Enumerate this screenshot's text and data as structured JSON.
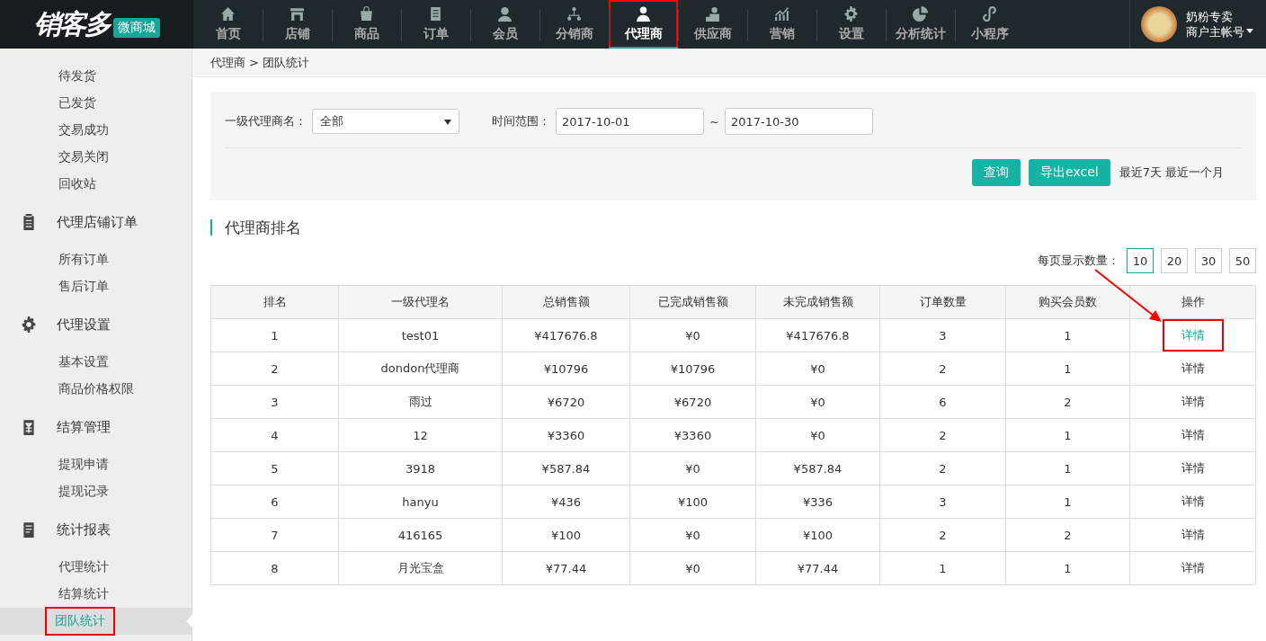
{
  "header": {
    "logo": "销客多",
    "logo_badge": "微商城",
    "nav": [
      {
        "label": "首页",
        "selected": false,
        "annotated": false
      },
      {
        "label": "店铺",
        "selected": false,
        "annotated": false
      },
      {
        "label": "商品",
        "selected": false,
        "annotated": false
      },
      {
        "label": "订单",
        "selected": false,
        "annotated": false
      },
      {
        "label": "会员",
        "selected": false,
        "annotated": false
      },
      {
        "label": "分销商",
        "selected": false,
        "annotated": false
      },
      {
        "label": "代理商",
        "selected": true,
        "annotated": true
      },
      {
        "label": "供应商",
        "selected": false,
        "annotated": false
      },
      {
        "label": "营销",
        "selected": false,
        "annotated": false
      },
      {
        "label": "设置",
        "selected": false,
        "annotated": false
      },
      {
        "label": "分析统计",
        "selected": false,
        "annotated": false
      },
      {
        "label": "小程序",
        "selected": false,
        "annotated": false
      }
    ],
    "account": {
      "name": "奶粉专卖",
      "role": "商户主帐号"
    }
  },
  "sidebar": [
    {
      "kind": "item",
      "label": "待发货",
      "selected": false,
      "annotated": false
    },
    {
      "kind": "item",
      "label": "已发货",
      "selected": false,
      "annotated": false
    },
    {
      "kind": "item",
      "label": "交易成功",
      "selected": false,
      "annotated": false
    },
    {
      "kind": "item",
      "label": "交易关闭",
      "selected": false,
      "annotated": false
    },
    {
      "kind": "item",
      "label": "回收站",
      "selected": false,
      "annotated": false
    },
    {
      "kind": "section",
      "label": "代理店铺订单"
    },
    {
      "kind": "item",
      "label": "所有订单",
      "selected": false,
      "annotated": false
    },
    {
      "kind": "item",
      "label": "售后订单",
      "selected": false,
      "annotated": false
    },
    {
      "kind": "section",
      "label": "代理设置"
    },
    {
      "kind": "item",
      "label": "基本设置",
      "selected": false,
      "annotated": false
    },
    {
      "kind": "item",
      "label": "商品价格权限",
      "selected": false,
      "annotated": false
    },
    {
      "kind": "section",
      "label": "结算管理"
    },
    {
      "kind": "item",
      "label": "提现申请",
      "selected": false,
      "annotated": false
    },
    {
      "kind": "item",
      "label": "提现记录",
      "selected": false,
      "annotated": false
    },
    {
      "kind": "section",
      "label": "统计报表"
    },
    {
      "kind": "item",
      "label": "代理统计",
      "selected": false,
      "annotated": false
    },
    {
      "kind": "item",
      "label": "结算统计",
      "selected": false,
      "annotated": false
    },
    {
      "kind": "item",
      "label": "团队统计",
      "selected": true,
      "annotated": true
    }
  ],
  "breadcrumb": [
    "代理商",
    "团队统计"
  ],
  "breadcrumb_separator": ">",
  "filters": {
    "agent_label": "一级代理商名：",
    "agent_value": "全部",
    "date_label": "时间范围：",
    "date_from": "2017-10-01",
    "date_separator": "~",
    "date_to": "2017-10-30",
    "buttons": [
      "查询",
      "导出excel"
    ],
    "quick_ranges": [
      "最近7天",
      "最近一个月"
    ]
  },
  "section_title": "代理商排名",
  "page_size": {
    "label": "每页显示数量：",
    "options": [
      {
        "label": "10",
        "selected": true
      },
      {
        "label": "20",
        "selected": false
      },
      {
        "label": "30",
        "selected": false
      },
      {
        "label": "50",
        "selected": false
      }
    ]
  },
  "table": {
    "columns": [
      "排名",
      "一级代理名",
      "总销售额",
      "已完成销售额",
      "未完成销售额",
      "订单数量",
      "购买会员数",
      "操作"
    ],
    "rows": [
      {
        "cells": [
          "1",
          "test01",
          "¥417676.8",
          "¥0",
          "¥417676.8",
          "3",
          "1"
        ],
        "action": "详情",
        "highlighted": true,
        "annotated": true
      },
      {
        "cells": [
          "2",
          "dondon代理商",
          "¥10796",
          "¥10796",
          "¥0",
          "2",
          "1"
        ],
        "action": "详情",
        "highlighted": false,
        "annotated": false
      },
      {
        "cells": [
          "3",
          "雨过",
          "¥6720",
          "¥6720",
          "¥0",
          "6",
          "2"
        ],
        "action": "详情",
        "highlighted": false,
        "annotated": false
      },
      {
        "cells": [
          "4",
          "12",
          "¥3360",
          "¥3360",
          "¥0",
          "2",
          "1"
        ],
        "action": "详情",
        "highlighted": false,
        "annotated": false
      },
      {
        "cells": [
          "5",
          "3918",
          "¥587.84",
          "¥0",
          "¥587.84",
          "2",
          "1"
        ],
        "action": "详情",
        "highlighted": false,
        "annotated": false
      },
      {
        "cells": [
          "6",
          "hanyu",
          "¥436",
          "¥100",
          "¥336",
          "3",
          "1"
        ],
        "action": "详情",
        "highlighted": false,
        "annotated": false
      },
      {
        "cells": [
          "7",
          "416165",
          "¥100",
          "¥0",
          "¥100",
          "2",
          "2"
        ],
        "action": "详情",
        "highlighted": false,
        "annotated": false
      },
      {
        "cells": [
          "8",
          "月光宝盒",
          "¥77.44",
          "¥0",
          "¥77.44",
          "1",
          "1"
        ],
        "action": "详情",
        "highlighted": false,
        "annotated": false
      }
    ]
  }
}
